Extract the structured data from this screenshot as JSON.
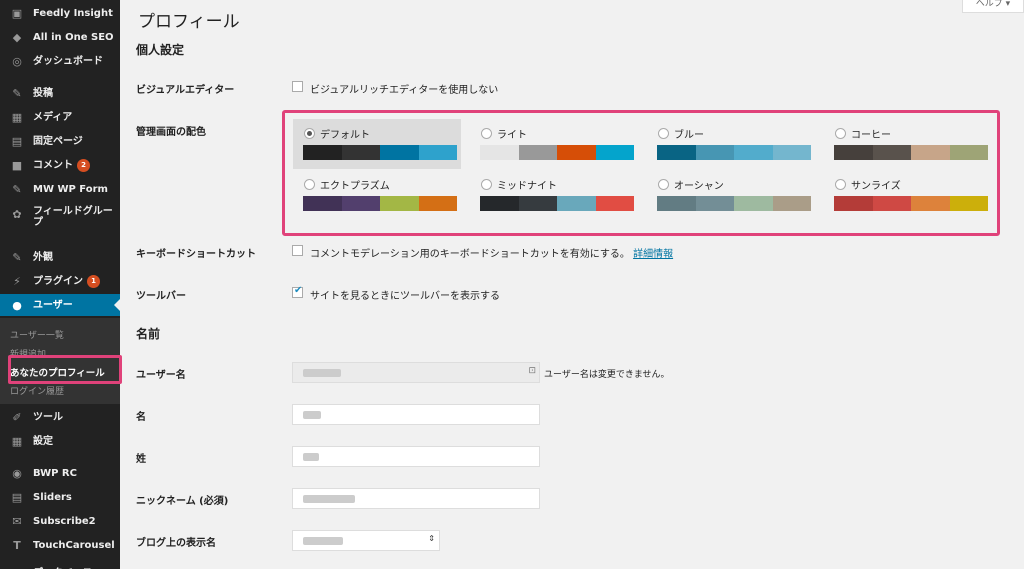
{
  "sidebar": {
    "items": [
      {
        "label": "Feedly Insight",
        "icon": "feedly-icon",
        "glyph": "▣"
      },
      {
        "label": "All in One SEO",
        "icon": "shield-icon",
        "glyph": "◆"
      },
      {
        "label": "ダッシュボード",
        "icon": "dashboard-icon",
        "glyph": "◎"
      },
      {
        "label": "投稿",
        "icon": "pin-icon",
        "glyph": "✎"
      },
      {
        "label": "メディア",
        "icon": "media-icon",
        "glyph": "▦"
      },
      {
        "label": "固定ページ",
        "icon": "page-icon",
        "glyph": "▤"
      },
      {
        "label": "コメント",
        "icon": "comment-icon",
        "glyph": "■",
        "badge": "2"
      },
      {
        "label": "MW WP Form",
        "icon": "pin-icon",
        "glyph": "✎"
      },
      {
        "label": "フィールドグループ",
        "icon": "acf-icon",
        "glyph": "✿"
      },
      {
        "label": "外観",
        "icon": "brush-icon",
        "glyph": "✎"
      },
      {
        "label": "プラグイン",
        "icon": "plugin-icon",
        "glyph": "⚡",
        "badge": "1"
      },
      {
        "label": "ユーザー",
        "icon": "user-icon",
        "glyph": "●",
        "active": true
      },
      {
        "label": "ツール",
        "icon": "wrench-icon",
        "glyph": "✐"
      },
      {
        "label": "設定",
        "icon": "settings-icon",
        "glyph": "▦"
      },
      {
        "label": "BWP RC",
        "icon": "bwp-icon",
        "glyph": "◉"
      },
      {
        "label": "Sliders",
        "icon": "sliders-icon",
        "glyph": "▤"
      },
      {
        "label": "Subscribe2",
        "icon": "mail-icon",
        "glyph": "✉"
      },
      {
        "label": "TouchCarousel",
        "icon": "touchcarousel-icon",
        "glyph": "T"
      },
      {
        "label": "データベース",
        "icon": "database-icon",
        "glyph": "▦"
      }
    ],
    "submenu": [
      "ユーザー一覧",
      "新規追加",
      "あなたのプロフィール",
      "ログイン履歴"
    ]
  },
  "page": {
    "title": "プロフィール",
    "help": "ヘルプ ▾",
    "section_personal": "個人設定",
    "visual_editor_label": "ビジュアルエディター",
    "visual_editor_option": "ビジュアルリッチエディターを使用しない",
    "color_scheme_label": "管理画面の配色",
    "keyboard_label": "キーボードショートカット",
    "keyboard_option": "コメントモデレーション用のキーボードショートカットを有効にする。",
    "keyboard_link": "詳細情報",
    "toolbar_label": "ツールバー",
    "toolbar_option": "サイトを見るときにツールバーを表示する",
    "section_name": "名前",
    "username_label": "ユーザー名",
    "username_note": "ユーザー名は変更できません。",
    "first_name_label": "名",
    "last_name_label": "姓",
    "nickname_label": "ニックネーム (必須)",
    "display_name_label": "ブログ上の表示名"
  },
  "schemes": [
    {
      "name": "デフォルト",
      "colors": [
        "#222222",
        "#333333",
        "#0074a2",
        "#2ea2cc"
      ],
      "selected": true
    },
    {
      "name": "ライト",
      "colors": [
        "#e5e5e5",
        "#999999",
        "#d64e07",
        "#04a4cc"
      ]
    },
    {
      "name": "ブルー",
      "colors": [
        "#096484",
        "#4796b3",
        "#52accc",
        "#74b6ce"
      ]
    },
    {
      "name": "コーヒー",
      "colors": [
        "#46403c",
        "#59524c",
        "#c7a589",
        "#9ea476"
      ]
    },
    {
      "name": "エクトプラズム",
      "colors": [
        "#413256",
        "#523f6d",
        "#a3b745",
        "#d46f15"
      ]
    },
    {
      "name": "ミッドナイト",
      "colors": [
        "#25282b",
        "#363b3f",
        "#69a8bb",
        "#e14d43"
      ]
    },
    {
      "name": "オーシャン",
      "colors": [
        "#627c83",
        "#738e96",
        "#9ebaa0",
        "#aa9d88"
      ]
    },
    {
      "name": "サンライズ",
      "colors": [
        "#b43c38",
        "#cf4944",
        "#dd823b",
        "#ccaf0b"
      ]
    }
  ]
}
